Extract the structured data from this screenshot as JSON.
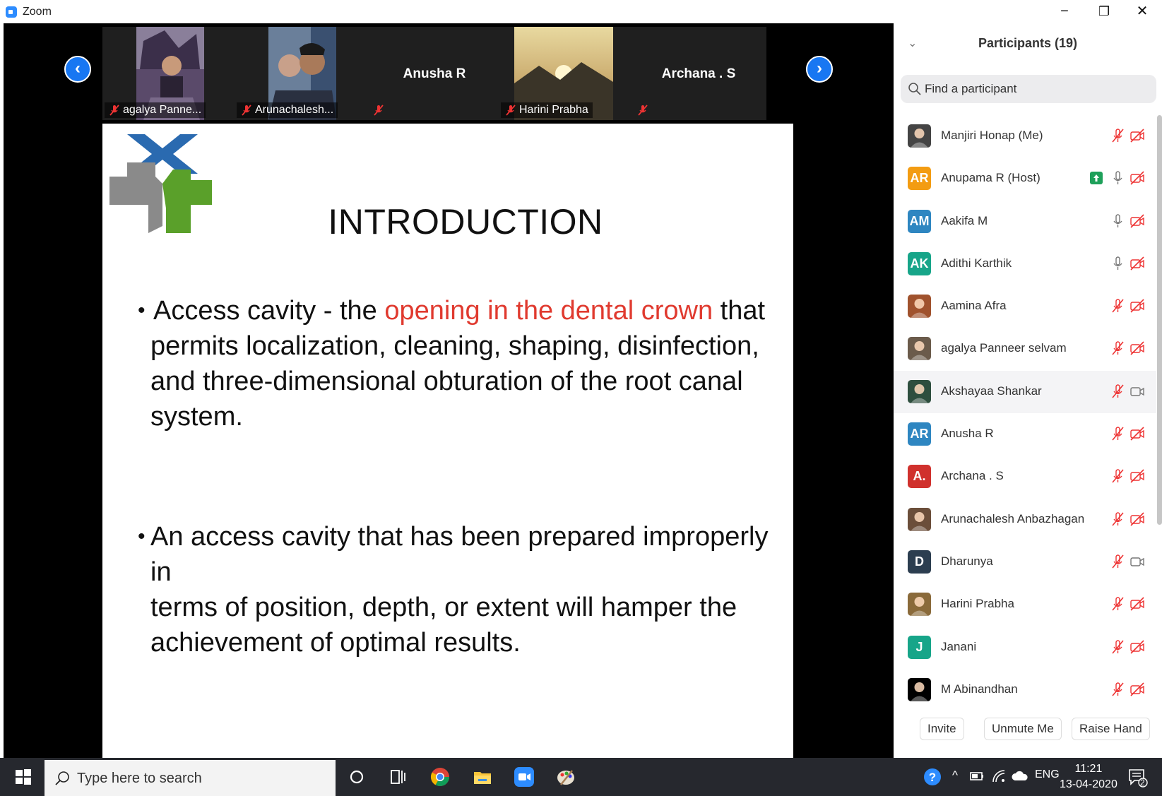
{
  "window": {
    "title": "Zoom",
    "minimize": "−",
    "restore": "❐",
    "close": "✕"
  },
  "video_strip": {
    "prev_arrow": "‹",
    "next_arrow": "›",
    "tiles": [
      {
        "name": "agalya Panne...",
        "type": "photo"
      },
      {
        "name": "Arunachalesh...",
        "type": "photo"
      },
      {
        "name": "Anusha R",
        "type": "name-only"
      },
      {
        "name": "Harini Prabha",
        "type": "photo"
      },
      {
        "name": "Archana . S",
        "type": "name-only"
      }
    ]
  },
  "slide": {
    "title": "INTRODUCTION",
    "bullet1": {
      "dot": "•",
      "pre": "Access cavity - the ",
      "highlight": "opening in the dental crown",
      "post": " that",
      "line2": "permits localization, cleaning, shaping, disinfection,",
      "line3": "and three-dimensional obturation of the root canal",
      "line4": "system."
    },
    "bullet2": {
      "dot": "•",
      "line1": "An access cavity that has been prepared improperly in",
      "line2": "terms of position, depth, or extent will hamper the",
      "line3": "achievement of optimal results."
    },
    "highlight_color": "#e03a2f"
  },
  "participants_panel": {
    "header": "Participants (19)",
    "collapse_icon": "⌄",
    "search_placeholder": "Find a participant",
    "participants": [
      {
        "name": "Manjiri Honap (Me)",
        "avatar": "",
        "avatar_color": "#444",
        "mic": "muted",
        "cam": "off"
      },
      {
        "name": "Anupama R (Host)",
        "avatar": "AR",
        "avatar_color": "#f39c12",
        "mic": "on",
        "cam": "off",
        "share": true
      },
      {
        "name": "Aakifa M",
        "avatar": "AM",
        "avatar_color": "#2e86c1",
        "mic": "on",
        "cam": "off"
      },
      {
        "name": "Adithi Karthik",
        "avatar": "AK",
        "avatar_color": "#17a589",
        "mic": "on",
        "cam": "off"
      },
      {
        "name": "Aamina Afra",
        "avatar": "",
        "avatar_color": "#a0522d",
        "mic": "muted",
        "cam": "off"
      },
      {
        "name": "agalya Panneer selvam",
        "avatar": "",
        "avatar_color": "#6b5b4b",
        "mic": "muted",
        "cam": "off"
      },
      {
        "name": "Akshayaa Shankar",
        "avatar": "",
        "avatar_color": "#2e4e3e",
        "mic": "muted",
        "cam": "on",
        "highlight": true
      },
      {
        "name": "Anusha R",
        "avatar": "AR",
        "avatar_color": "#2e86c1",
        "mic": "muted",
        "cam": "off"
      },
      {
        "name": "Archana . S",
        "avatar": "A.",
        "avatar_color": "#d0312d",
        "mic": "muted",
        "cam": "off"
      },
      {
        "name": "Arunachalesh Anbazhagan",
        "avatar": "",
        "avatar_color": "#6b4e3a",
        "mic": "muted",
        "cam": "off"
      },
      {
        "name": "Dharunya",
        "avatar": "D",
        "avatar_color": "#2c3e50",
        "mic": "muted",
        "cam": "on"
      },
      {
        "name": "Harini Prabha",
        "avatar": "",
        "avatar_color": "#8a6a3a",
        "mic": "muted",
        "cam": "off"
      },
      {
        "name": "Janani",
        "avatar": "J",
        "avatar_color": "#17a589",
        "mic": "muted",
        "cam": "off"
      },
      {
        "name": "M Abinandhan",
        "avatar": "",
        "avatar_color": "#000",
        "mic": "muted",
        "cam": "off"
      }
    ],
    "buttons": {
      "invite": "Invite",
      "unmute": "Unmute Me",
      "raise_hand": "Raise Hand"
    }
  },
  "taskbar": {
    "search_placeholder": "Type here to search",
    "tray_lang": "ENG",
    "tray_chevron": "^",
    "time": "11:21",
    "date": "13-04-2020",
    "notification_count": "2"
  }
}
